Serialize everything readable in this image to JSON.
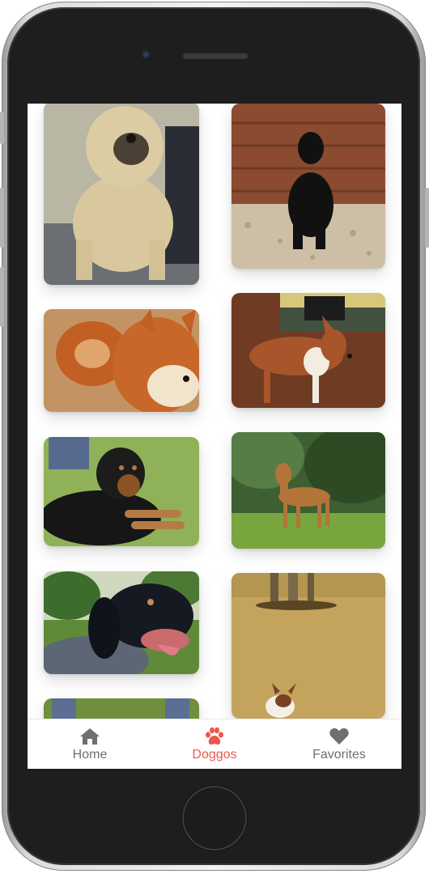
{
  "tabs": [
    {
      "label": "Home",
      "icon": "home-icon",
      "active": false
    },
    {
      "label": "Doggos",
      "icon": "paw-icon",
      "active": true
    },
    {
      "label": "Favorites",
      "icon": "heart-icon",
      "active": false
    }
  ],
  "colors": {
    "active_tab": "#f0564a",
    "inactive_tab": "#6f6f6f",
    "background": "#ffffff"
  },
  "dog_photos": [
    {
      "subject": "shaggy-wheaten-dog"
    },
    {
      "subject": "black-dog-on-gravel"
    },
    {
      "subject": "shiba-inu"
    },
    {
      "subject": "basenji"
    },
    {
      "subject": "black-and-tan-dog-lying-on-grass"
    },
    {
      "subject": "slim-tan-hound-on-grass"
    },
    {
      "subject": "bluetick-hound"
    },
    {
      "subject": "dog-on-dry-field"
    },
    {
      "subject": "partial-photo-bottom"
    }
  ]
}
